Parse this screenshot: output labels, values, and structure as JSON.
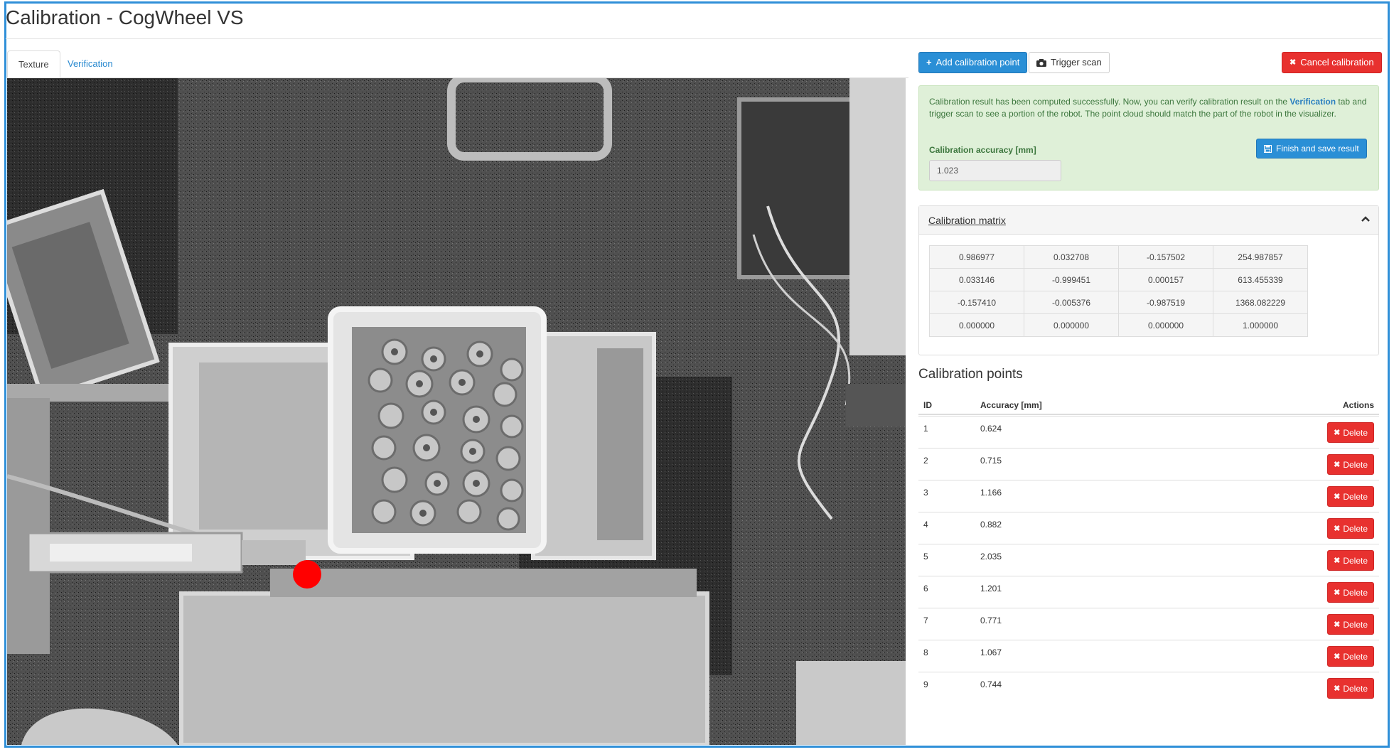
{
  "page": {
    "title": "Calibration - CogWheel VS"
  },
  "tabs": [
    {
      "label": "Texture",
      "active": true
    },
    {
      "label": "Verification",
      "active": false
    }
  ],
  "toolbar": {
    "add_label": "Add calibration point",
    "trigger_label": "Trigger scan",
    "cancel_label": "Cancel calibration"
  },
  "alert": {
    "text_before": "Calibration result has been computed successfully. Now, you can verify calibration result on the ",
    "link": "Verification",
    "text_after": " tab and trigger scan to see a portion of the robot. The point cloud should match the part of the robot in the visualizer.",
    "accuracy_label": "Calibration accuracy [mm]",
    "accuracy_value": "1.023",
    "finish_label": "Finish and save result"
  },
  "matrix": {
    "title": "Calibration matrix",
    "rows": [
      [
        "0.986977",
        "0.032708",
        "-0.157502",
        "254.987857"
      ],
      [
        "0.033146",
        "-0.999451",
        "0.000157",
        "613.455339"
      ],
      [
        "-0.157410",
        "-0.005376",
        "-0.987519",
        "1368.082229"
      ],
      [
        "0.000000",
        "0.000000",
        "0.000000",
        "1.000000"
      ]
    ]
  },
  "points": {
    "title": "Calibration points",
    "headers": {
      "id": "ID",
      "accuracy": "Accuracy [mm]",
      "actions": "Actions"
    },
    "delete_label": "Delete",
    "rows": [
      {
        "id": "1",
        "accuracy": "0.624"
      },
      {
        "id": "2",
        "accuracy": "0.715"
      },
      {
        "id": "3",
        "accuracy": "1.166"
      },
      {
        "id": "4",
        "accuracy": "0.882"
      },
      {
        "id": "5",
        "accuracy": "2.035"
      },
      {
        "id": "6",
        "accuracy": "1.201"
      },
      {
        "id": "7",
        "accuracy": "0.771"
      },
      {
        "id": "8",
        "accuracy": "1.067"
      },
      {
        "id": "9",
        "accuracy": "0.744"
      }
    ]
  },
  "colors": {
    "primary": "#2a8fd6",
    "danger": "#e8312f",
    "success_bg": "#dff0d8",
    "marker": "#ff0000"
  }
}
